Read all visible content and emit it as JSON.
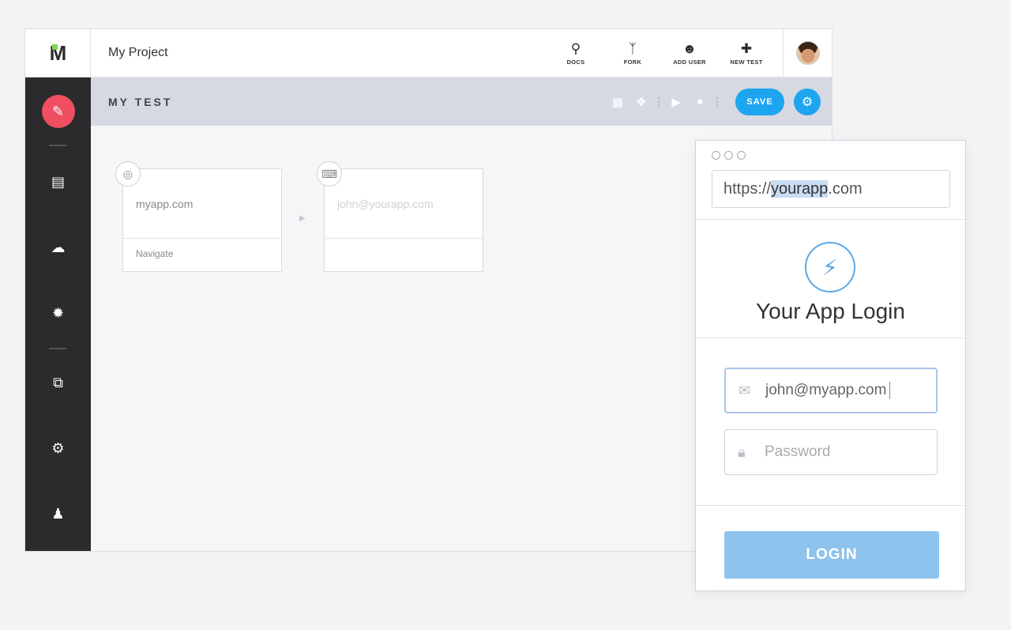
{
  "header": {
    "logo": "M",
    "project_title": "My Project",
    "actions": [
      {
        "label": "DOCS",
        "icon": "lightbulb-icon"
      },
      {
        "label": "FORK",
        "icon": "fork-icon"
      },
      {
        "label": "ADD USER",
        "icon": "add-user-icon"
      },
      {
        "label": "NEW TEST",
        "icon": "plus-icon"
      }
    ]
  },
  "subbar": {
    "test_title": "MY TEST",
    "save_label": "SAVE"
  },
  "steps": [
    {
      "url": "myapp.com",
      "action": "Navigate"
    },
    {
      "url": "john@yourapp.com",
      "action": ""
    }
  ],
  "browser": {
    "url_prefix": "https://",
    "url_highlight": "yourapp",
    "url_suffix": ".com",
    "app_title": "Your App Login",
    "email_value": "john@myapp.com",
    "password_placeholder": "Password",
    "login_label": "LOGIN"
  },
  "colors": {
    "accent": "#1ea5f0",
    "edit_button": "#ef4f61",
    "sidebar": "#2b2b2d",
    "login_button": "#8ec3ee"
  }
}
